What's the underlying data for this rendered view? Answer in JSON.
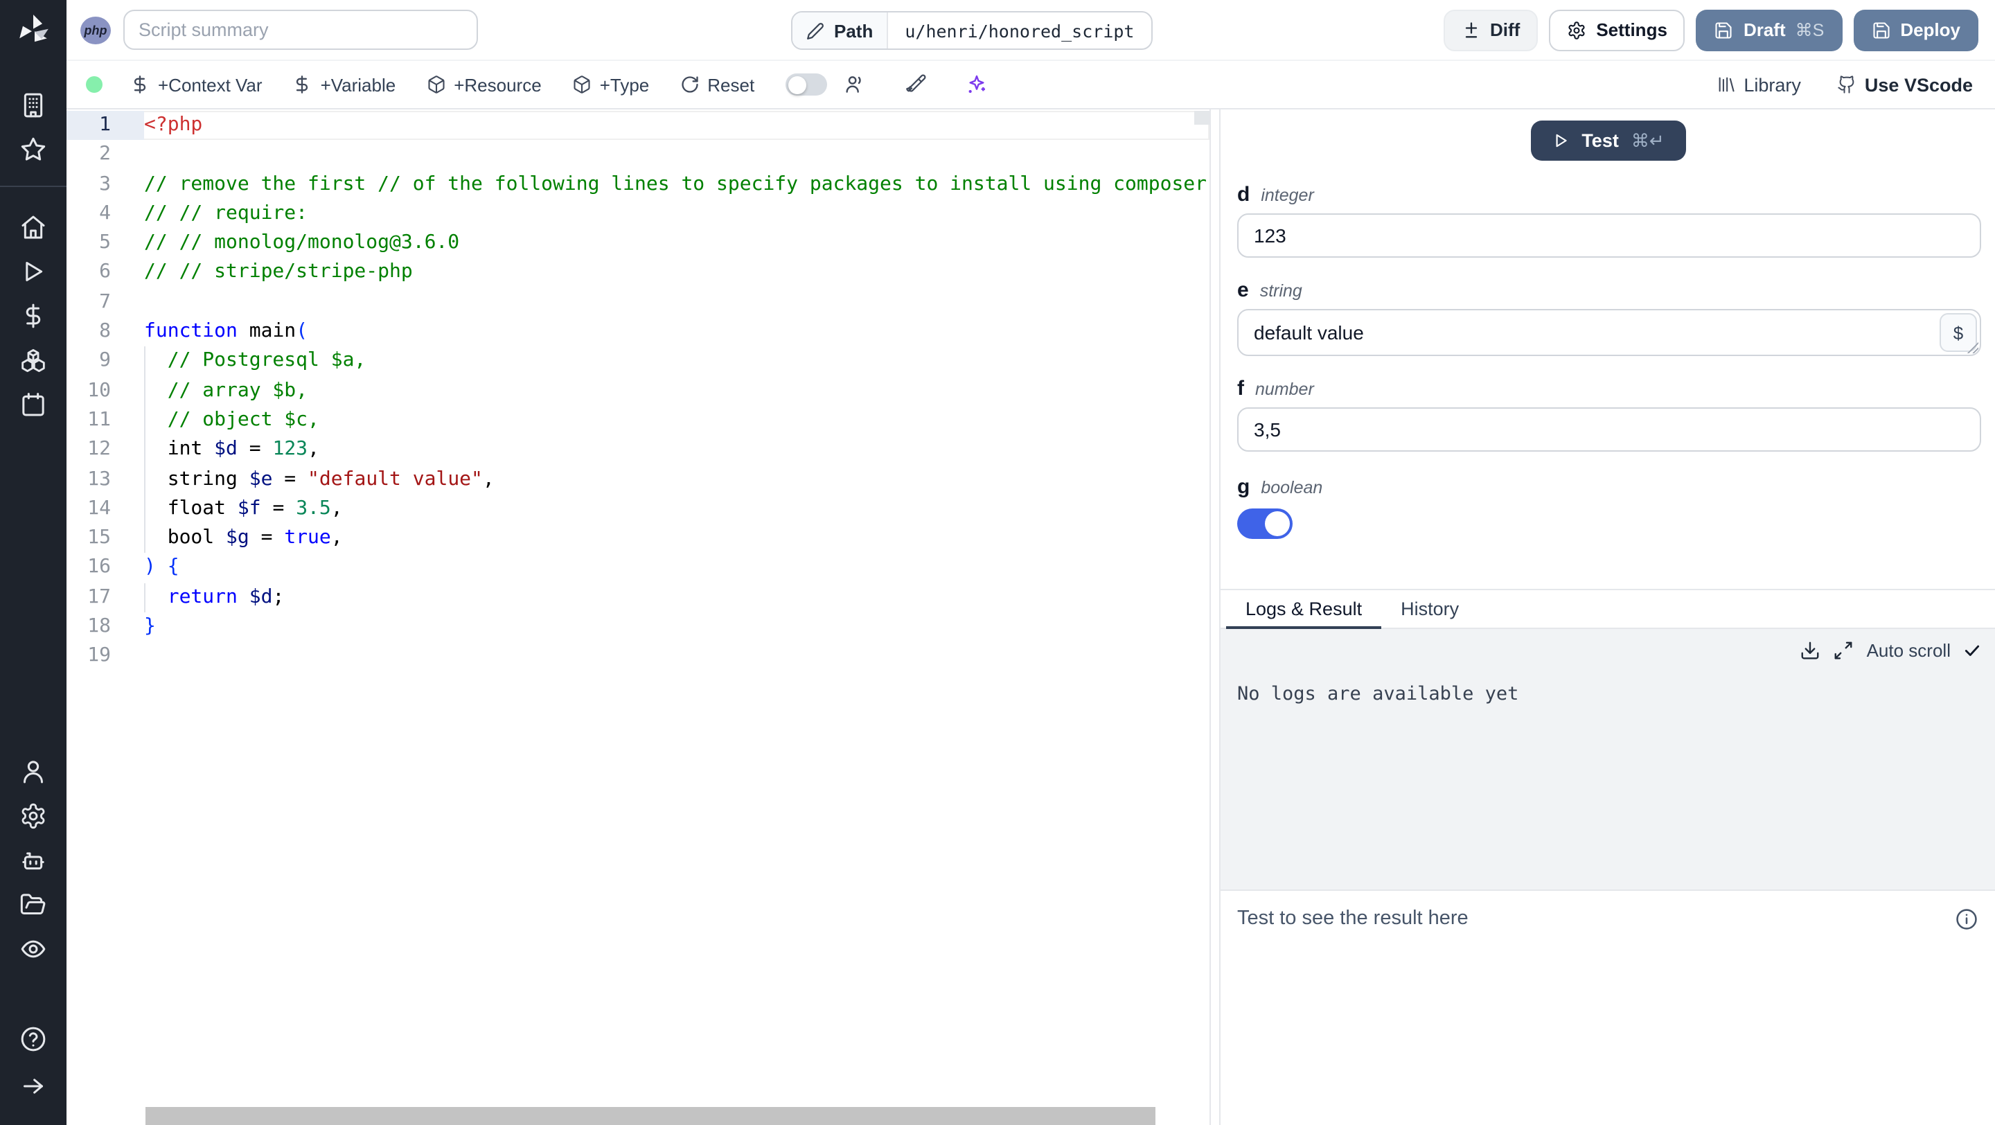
{
  "header": {
    "language_badge": "php",
    "summary_placeholder": "Script summary",
    "path_label": "Path",
    "path_value": "u/henri/honored_script",
    "diff_label": "Diff",
    "settings_label": "Settings",
    "draft_label": "Draft",
    "draft_shortcut": "⌘S",
    "deploy_label": "Deploy"
  },
  "toolbar": {
    "add_context_var": "+Context Var",
    "add_variable": "+Variable",
    "add_resource": "+Resource",
    "add_type": "+Type",
    "reset": "Reset",
    "library": "Library",
    "use_vscode": "Use VScode",
    "status_dot_color": "#86efac",
    "ai_icon_color": "#7c3aed"
  },
  "sidebar": {
    "icons": [
      "windmill-logo",
      "building-icon",
      "star-icon",
      "home-icon",
      "runs-play-icon",
      "variables-dollar-icon",
      "resources-boxes-icon",
      "schedules-calendar-icon",
      "user-icon",
      "settings-gear-icon",
      "workers-bot-icon",
      "folders-icon",
      "audit-eye-icon",
      "help-icon",
      "expand-arrow-icon"
    ]
  },
  "editor": {
    "lines": [
      {
        "num": 1,
        "active": true,
        "guide": false,
        "tokens": [
          [
            "tag",
            "<?php"
          ]
        ]
      },
      {
        "num": 2,
        "active": false,
        "guide": false,
        "tokens": []
      },
      {
        "num": 3,
        "active": false,
        "guide": false,
        "tokens": [
          [
            "comment",
            "// remove the first // of the following lines to specify packages to install using composer:"
          ]
        ]
      },
      {
        "num": 4,
        "active": false,
        "guide": false,
        "tokens": [
          [
            "comment",
            "// // require:"
          ]
        ]
      },
      {
        "num": 5,
        "active": false,
        "guide": false,
        "tokens": [
          [
            "comment",
            "// // monolog/monolog@3.6.0"
          ]
        ]
      },
      {
        "num": 6,
        "active": false,
        "guide": false,
        "tokens": [
          [
            "comment",
            "// // stripe/stripe-php"
          ]
        ]
      },
      {
        "num": 7,
        "active": false,
        "guide": false,
        "tokens": []
      },
      {
        "num": 8,
        "active": false,
        "guide": false,
        "tokens": [
          [
            "kw",
            "function"
          ],
          [
            "plain",
            " main"
          ],
          [
            "br",
            "("
          ]
        ]
      },
      {
        "num": 9,
        "active": false,
        "guide": true,
        "tokens": [
          [
            "comment",
            "  // Postgresql $a,"
          ]
        ]
      },
      {
        "num": 10,
        "active": false,
        "guide": true,
        "tokens": [
          [
            "comment",
            "  // array $b,"
          ]
        ]
      },
      {
        "num": 11,
        "active": false,
        "guide": true,
        "tokens": [
          [
            "comment",
            "  // object $c,"
          ]
        ]
      },
      {
        "num": 12,
        "active": false,
        "guide": true,
        "tokens": [
          [
            "plain",
            "  int "
          ],
          [
            "var",
            "$d"
          ],
          [
            "plain",
            " = "
          ],
          [
            "num",
            "123"
          ],
          [
            "plain",
            ","
          ]
        ]
      },
      {
        "num": 13,
        "active": false,
        "guide": true,
        "tokens": [
          [
            "plain",
            "  string "
          ],
          [
            "var",
            "$e"
          ],
          [
            "plain",
            " = "
          ],
          [
            "str",
            "\"default value\""
          ],
          [
            "plain",
            ","
          ]
        ]
      },
      {
        "num": 14,
        "active": false,
        "guide": true,
        "tokens": [
          [
            "plain",
            "  float "
          ],
          [
            "var",
            "$f"
          ],
          [
            "plain",
            " = "
          ],
          [
            "num",
            "3.5"
          ],
          [
            "plain",
            ","
          ]
        ]
      },
      {
        "num": 15,
        "active": false,
        "guide": true,
        "tokens": [
          [
            "plain",
            "  bool "
          ],
          [
            "var",
            "$g"
          ],
          [
            "plain",
            " = "
          ],
          [
            "kw",
            "true"
          ],
          [
            "plain",
            ","
          ]
        ]
      },
      {
        "num": 16,
        "active": false,
        "guide": false,
        "tokens": [
          [
            "br",
            ") {"
          ]
        ]
      },
      {
        "num": 17,
        "active": false,
        "guide": true,
        "tokens": [
          [
            "plain",
            "  "
          ],
          [
            "kw",
            "return"
          ],
          [
            "plain",
            " "
          ],
          [
            "var",
            "$d"
          ],
          [
            "plain",
            ";"
          ]
        ]
      },
      {
        "num": 18,
        "active": false,
        "guide": false,
        "tokens": [
          [
            "br",
            "}"
          ]
        ]
      },
      {
        "num": 19,
        "active": false,
        "guide": false,
        "tokens": []
      }
    ]
  },
  "panel": {
    "test_label": "Test",
    "test_shortcut": "⌘↵",
    "args": [
      {
        "name": "d",
        "type": "integer",
        "value": "123"
      },
      {
        "name": "e",
        "type": "string",
        "value": "default value",
        "dollar_button": "$"
      },
      {
        "name": "f",
        "type": "number",
        "value": "3,5"
      },
      {
        "name": "g",
        "type": "boolean",
        "value": true
      }
    ],
    "tabs": [
      {
        "label": "Logs & Result",
        "active": true
      },
      {
        "label": "History",
        "active": false
      }
    ],
    "autoscroll_label": "Auto scroll",
    "no_logs_text": "No logs are available yet",
    "result_placeholder": "Test to see the result here"
  },
  "colors": {
    "sidebar_bg": "#1e232c",
    "primary_button": "#647d9e",
    "test_button": "#33425b",
    "toggle_on": "#3f63e8",
    "logs_bg": "#f1f3f5"
  }
}
